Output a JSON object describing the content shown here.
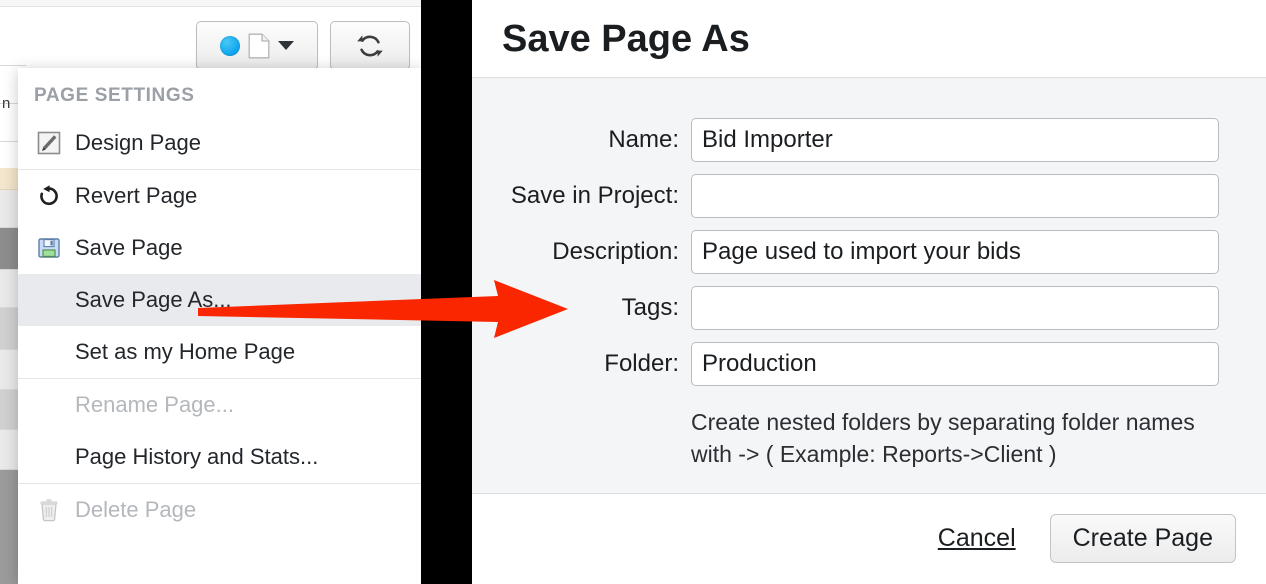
{
  "toolbar": {
    "page_select": {
      "status_icon": "blue-circle-icon",
      "page_icon": "document-icon",
      "caret_icon": "chevron-down-icon"
    },
    "refresh": {
      "icon": "refresh-icon"
    }
  },
  "background": {
    "text_snippet": "n"
  },
  "menu": {
    "section_label": "PAGE SETTINGS",
    "groups": [
      {
        "items": [
          {
            "label": "Design Page",
            "icon": "design-pencil-icon",
            "state": "normal"
          }
        ]
      },
      {
        "items": [
          {
            "label": "Revert Page",
            "icon": "revert-arrow-icon",
            "state": "normal"
          },
          {
            "label": "Save Page",
            "icon": "floppy-disk-icon",
            "state": "normal"
          },
          {
            "label": "Save Page As...",
            "icon": "",
            "state": "highlighted"
          },
          {
            "label": "Set as my Home Page",
            "icon": "",
            "state": "normal"
          }
        ]
      },
      {
        "items": [
          {
            "label": "Rename Page...",
            "icon": "",
            "state": "disabled"
          },
          {
            "label": "Page History and Stats...",
            "icon": "",
            "state": "normal"
          }
        ]
      },
      {
        "items": [
          {
            "label": "Delete Page",
            "icon": "trash-icon",
            "state": "disabled"
          }
        ]
      }
    ]
  },
  "dialog": {
    "title": "Save Page As",
    "fields": [
      {
        "label": "Name:",
        "value": "Bid Importer",
        "placeholder": ""
      },
      {
        "label": "Save in Project:",
        "value": "",
        "placeholder": ""
      },
      {
        "label": "Description:",
        "value": "Page used to import your bids",
        "placeholder": ""
      },
      {
        "label": "Tags:",
        "value": "",
        "placeholder": ""
      },
      {
        "label": "Folder:",
        "value": "Production",
        "placeholder": ""
      }
    ],
    "folder_hint": "Create nested folders by separating folder names with -> ( Example: Reports->Client )",
    "cancel_label": "Cancel",
    "create_label": "Create Page"
  },
  "annotation": {
    "arrow_icon": "red-arrow-icon",
    "color": "#FA2600"
  },
  "colors": {
    "accent_blue": "#14A8EF",
    "highlight": "#E8EAED",
    "panel_bg": "#F4F5F7",
    "border": "#DCDEE0",
    "disabled_text": "#B4B8BC"
  }
}
